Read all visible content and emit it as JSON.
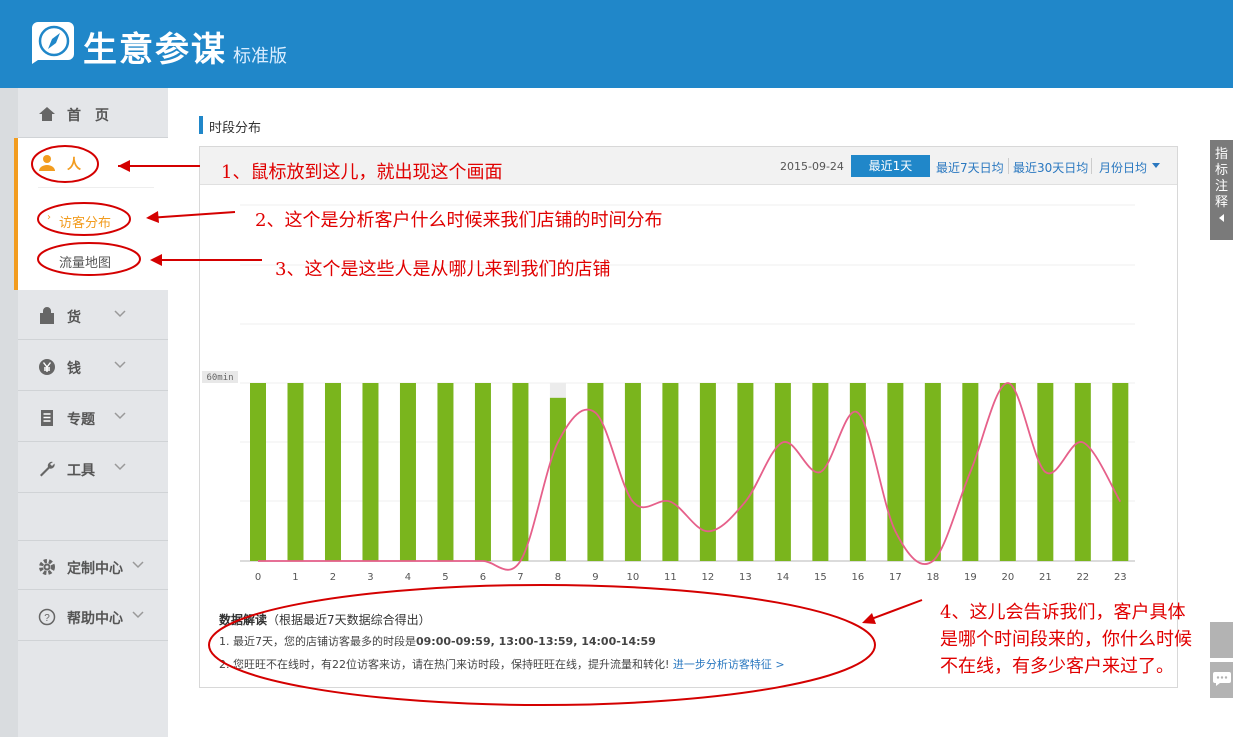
{
  "header": {
    "brand": "生意参谋",
    "edition": "标准版"
  },
  "sidebar": {
    "home": "首　页",
    "people": "人",
    "people_sub": [
      "访客分布",
      "流量地图"
    ],
    "goods": "货",
    "money": "钱",
    "topics": "专题",
    "tools": "工具",
    "custom": "定制中心",
    "help": "帮助中心"
  },
  "section": {
    "title": "时段分布"
  },
  "toolbar": {
    "date": "2015-09-24",
    "tabs": [
      "最近1天",
      "最近7天日均",
      "最近30天日均",
      "月份日均"
    ],
    "active_tab": "最近1天"
  },
  "chart_data": {
    "type": "bar",
    "categories": [
      "0",
      "1",
      "2",
      "3",
      "4",
      "5",
      "6",
      "7",
      "8",
      "9",
      "10",
      "11",
      "12",
      "13",
      "14",
      "15",
      "16",
      "17",
      "18",
      "19",
      "20",
      "21",
      "22",
      "23"
    ],
    "y_label_tag": "60min",
    "series": [
      {
        "kind": "bar",
        "values": [
          60,
          60,
          60,
          60,
          60,
          60,
          60,
          60,
          55,
          60,
          60,
          60,
          60,
          60,
          60,
          60,
          60,
          60,
          60,
          60,
          60,
          60,
          60,
          60
        ]
      },
      {
        "kind": "line",
        "values": [
          0,
          0,
          0,
          0,
          0,
          0,
          0,
          0,
          40,
          50,
          20,
          20,
          10,
          20,
          40,
          30,
          50,
          10,
          0,
          30,
          60,
          30,
          40,
          20
        ]
      }
    ],
    "ylim": [
      0,
      60
    ],
    "colors": {
      "bar": "#7ab51d",
      "line": "#e6608a"
    },
    "grid": true
  },
  "interpretation": {
    "title_bold": "数据解读",
    "title_note": "（根据最近7天数据综合得出）",
    "line1_prefix": "1. 最近7天，您的店铺访客最多的时段是",
    "line1_value": "09:00-09:59, 13:00-13:59, 14:00-14:59",
    "line2_text": "2. 您旺旺不在线时，有22位访客来访，请在热门来访时段，保持旺旺在线，提升流量和转化!",
    "line2_link": "进一步分析访客特征 >"
  },
  "annotations": {
    "a1": "1、鼠标放到这儿，就出现这个画面",
    "a2": "2、这个是分析客户什么时候来我们店铺的时间分布",
    "a3": "3、这个是这些人是从哪儿来到我们的店铺",
    "a4_l1": "4、这儿会告诉我们，客户具体",
    "a4_l2": "是哪个时间段来的，你什么时候",
    "a4_l3": "不在线，有多少客户来过了。"
  },
  "rail": {
    "note": "指标注释"
  }
}
